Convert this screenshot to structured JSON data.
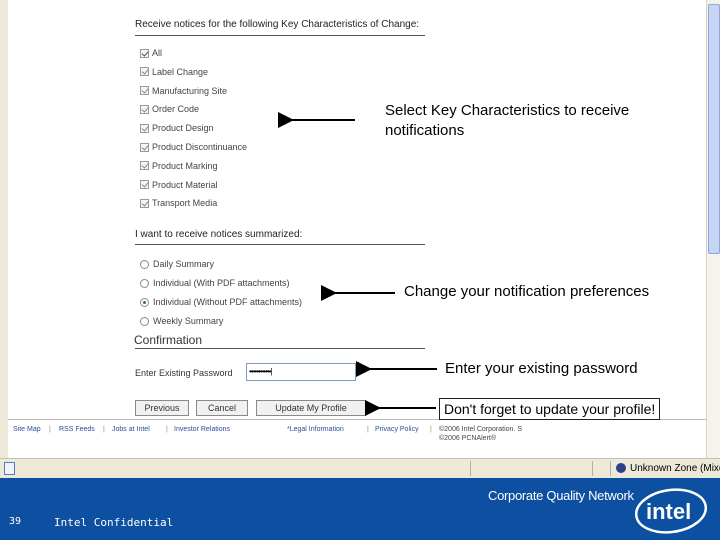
{
  "form": {
    "key_char_title": "Receive notices for the following Key Characteristics of Change:",
    "key_characteristics": [
      {
        "label": "All",
        "checked": true
      },
      {
        "label": "Label Change",
        "checked": true
      },
      {
        "label": "Manufacturing Site",
        "checked": true
      },
      {
        "label": "Order Code",
        "checked": true
      },
      {
        "label": "Product Design",
        "checked": true
      },
      {
        "label": "Product Discontinuance",
        "checked": true
      },
      {
        "label": "Product Marking",
        "checked": true
      },
      {
        "label": "Product Material",
        "checked": true
      },
      {
        "label": "Transport Media",
        "checked": true
      }
    ],
    "summary_title": "I want to receive notices summarized:",
    "summary_options": [
      {
        "label": "Daily Summary",
        "selected": false
      },
      {
        "label": "Individual (With PDF attachments)",
        "selected": false
      },
      {
        "label": "Individual (Without PDF attachments)",
        "selected": true
      },
      {
        "label": "Weekly Summary",
        "selected": false
      }
    ],
    "confirmation_title": "Confirmation",
    "password_label": "Enter Existing Password",
    "password_value": "••••••••••••|",
    "buttons": {
      "previous": "Previous",
      "cancel": "Cancel",
      "update": "Update My Profile"
    }
  },
  "footer_links": [
    "Site Map",
    "RSS Feeds",
    "Jobs at Intel",
    "Investor Relations",
    "*Legal Information",
    "Privacy Policy"
  ],
  "copyright": [
    "©2006 Intel Corporation. S",
    "©2006 PCNAlert®"
  ],
  "status_bar": {
    "zone": "Unknown Zone (Mixed)"
  },
  "callouts": {
    "key_characteristics": "Select Key Characteristics to receive notifications",
    "preferences": "Change your notification preferences",
    "password": "Enter your existing password",
    "update_profile": "Don't forget to update your profile!"
  },
  "slide_footer": {
    "slide_number": "39",
    "confidential": "Intel Confidential",
    "network_name": "Corporate Quality Network",
    "logo_text": "intel"
  },
  "colors": {
    "footer_bg": "#0d4fa0",
    "link": "#2a4f9a",
    "browser_chrome": "#ece9d8"
  }
}
